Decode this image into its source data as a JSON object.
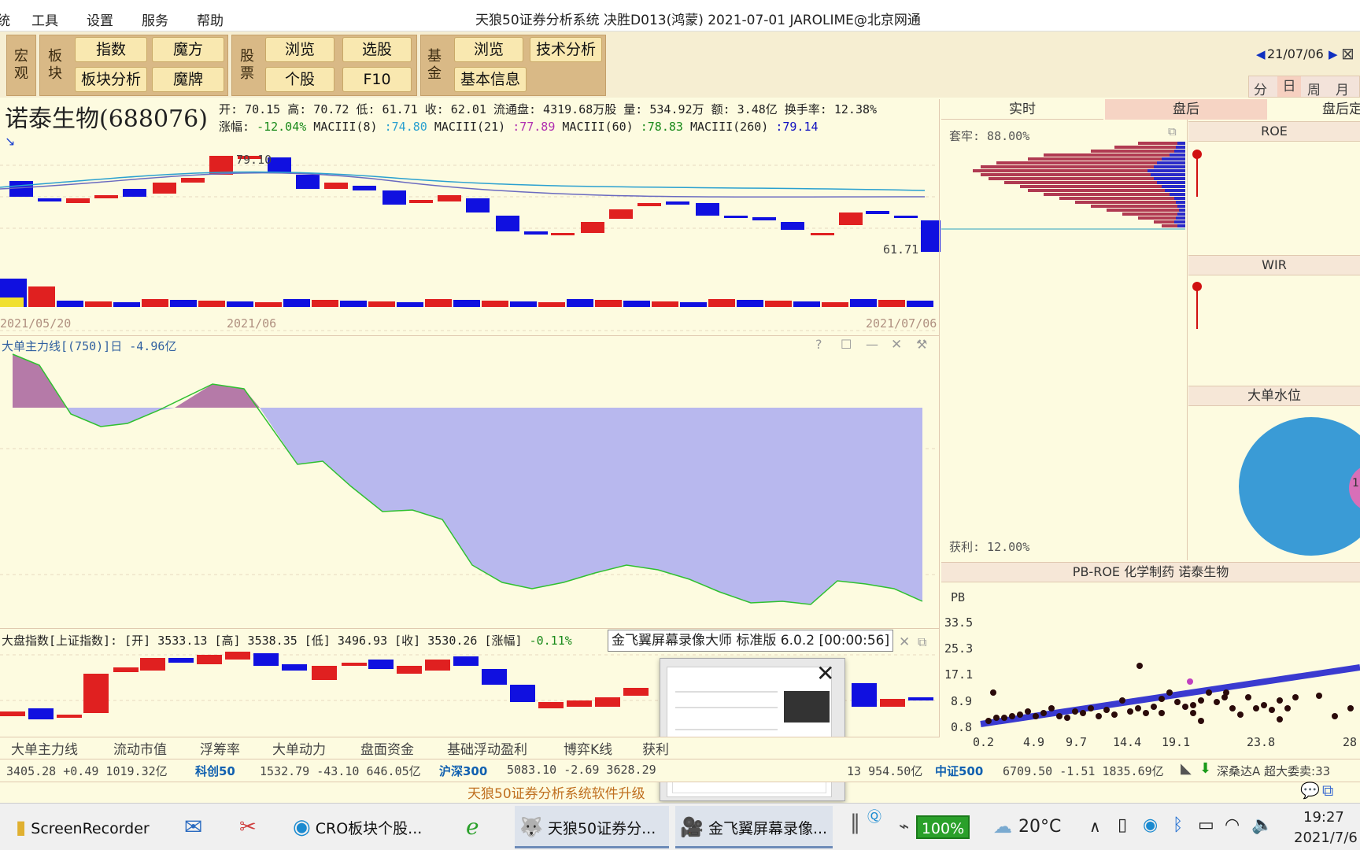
{
  "menu": {
    "items": [
      "工具",
      "设置",
      "服务",
      "帮助"
    ],
    "lead": "统"
  },
  "title": "天狼50证券分析系统  决胜D013(鸿蒙)  2021-07-01 JAROLIME@北京网通",
  "toolbar": {
    "macro": "宏观",
    "sector": "板块",
    "stock": "股票",
    "fund": "基金",
    "btn_index": "指数",
    "btn_magic": "魔方",
    "btn_sector_analysis": "板块分析",
    "btn_magic_card": "魔牌",
    "btn_browse": "浏览",
    "btn_select": "选股",
    "btn_single": "个股",
    "btn_f10": "F10",
    "btn_fund_browse": "浏览",
    "btn_tech": "技术分析",
    "btn_basic": "基本信息",
    "date": "21/07/06",
    "periods": [
      "分",
      "日",
      "周",
      "月"
    ]
  },
  "stock": {
    "name": "诺泰生物(688076)",
    "line1": "开: 70.15 高: 70.72 低: 61.71 收: 62.01 流通盘: 4319.68万股 量: 534.92万 额: 3.48亿 换手率: 12.38%",
    "change_label": "涨幅: ",
    "change": "-12.04%",
    "ma8_label": " MACIII(8) ",
    "ma8": ":74.80",
    "ma21_label": " MACIII(21) ",
    "ma21": ":77.89",
    "ma60_label": " MACIII(60) ",
    "ma60": ":78.83",
    "ma260_label": " MACIII(260) ",
    "ma260": ":79.14",
    "high_mark": "79.10",
    "low_mark": "61.71",
    "dates": [
      "2021/05/20",
      "2021/06",
      "2021/07/06"
    ]
  },
  "flow": {
    "title": "大单主力线[(750)]日 -4.96亿"
  },
  "index_panel": {
    "title": "大盘指数[上证指数]: [开] 3533.13 [高] 3538.35 [低] 3496.93 [收] 3530.26 [涨幅] ",
    "change": "-0.11%"
  },
  "tooltip": "金飞翼屏幕录像大师 标准版 6.0.2 [00:00:56]",
  "right": {
    "tabs": [
      "实时",
      "盘后",
      "盘后定"
    ],
    "trapped": "套牢: 88.00%",
    "profit": "获利: 12.00%",
    "roe": "ROE",
    "wir": "WIR",
    "water": "大单水位",
    "pie_label": "1",
    "pbroe_title": "PB-ROE 化学制药 诺泰生物",
    "pb_label": "PB",
    "y_ticks": [
      "33.5",
      "25.3",
      "17.1",
      "8.9",
      "0.8"
    ],
    "x_ticks": [
      "0.2",
      "4.9",
      "9.7",
      "14.4",
      "19.1",
      "23.8",
      "28"
    ]
  },
  "bottom_tabs": [
    "大单主力线",
    "流动市值",
    "浮筹率",
    "大单动力",
    "盘面资金",
    "基础浮动盈利",
    "博弈K线",
    "获利"
  ],
  "ticker": [
    {
      "v": "3405.28  +0.49  1019.32亿"
    },
    {
      "name": "科创50"
    },
    {
      "v": "1532.79  -43.10  646.05亿"
    },
    {
      "name": "沪深300"
    },
    {
      "v": "5083.10  -2.69  3628.29"
    },
    {
      "v": "13  954.50亿"
    },
    {
      "name": "中证500"
    },
    {
      "v": "6709.50  -1.51  1835.69亿"
    },
    {
      "v": "深桑达A  超大委卖:33"
    }
  ],
  "upgrade": "天狼50证券分析系统软件升级",
  "taskbar": {
    "items": [
      "ScreenRecorder",
      "CRO板块个股...",
      "天狼50证券分...",
      "金飞翼屏幕录像..."
    ],
    "battery": "100%",
    "temp": "20°C",
    "time": "19:27",
    "date": "2021/7/6"
  },
  "colors": {
    "up": "#e02020",
    "down": "#1010e0",
    "bg": "#fdfbe0",
    "flow_pos": "#b57aa8",
    "flow_neg": "#b8b8ee",
    "line_green": "#30c030"
  }
}
